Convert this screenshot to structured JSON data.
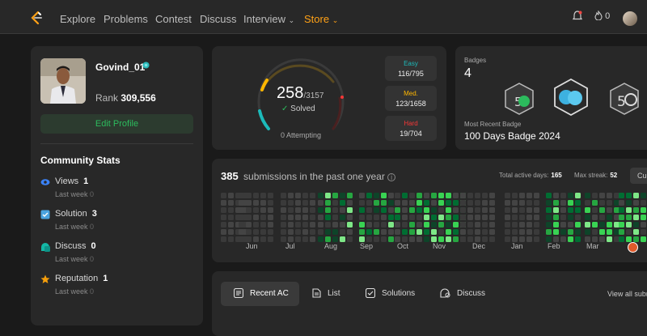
{
  "nav": {
    "links": [
      "Explore",
      "Problems",
      "Contest",
      "Discuss",
      "Interview",
      "Store"
    ],
    "coins": "0"
  },
  "profile": {
    "username": "Govind_01",
    "rank_label": "Rank",
    "rank_value": "309,556",
    "edit_label": "Edit Profile",
    "community_title": "Community Stats",
    "stats": [
      {
        "label": "Views",
        "value": "1",
        "sub_label": "Last week",
        "sub_value": "0",
        "icon": "eye-icon"
      },
      {
        "label": "Solution",
        "value": "3",
        "sub_label": "Last week",
        "sub_value": "0",
        "icon": "solution-icon"
      },
      {
        "label": "Discuss",
        "value": "0",
        "sub_label": "Last week",
        "sub_value": "0",
        "icon": "discuss-icon"
      },
      {
        "label": "Reputation",
        "value": "1",
        "sub_label": "Last week",
        "sub_value": "0",
        "icon": "star-icon"
      }
    ]
  },
  "solved": {
    "count": "258",
    "total": "/3157",
    "label": "Solved",
    "attempting": "0 Attempting",
    "easy": {
      "label": "Easy",
      "value": "116/795",
      "color": "#1cbaba"
    },
    "medium": {
      "label": "Med.",
      "value": "123/1658",
      "color": "#ffb700"
    },
    "hard": {
      "label": "Hard",
      "value": "19/704",
      "color": "#f63737"
    }
  },
  "badges": {
    "label": "Badges",
    "count": "4",
    "recent_label": "Most Recent Badge",
    "recent_name": "100 Days Badge 2024"
  },
  "submissions": {
    "count": "385",
    "text": "submissions in the past one year",
    "active_label": "Total active days:",
    "active_value": "165",
    "streak_label": "Max streak:",
    "streak_value": "52",
    "current_label": "Cur",
    "months": [
      "Jun",
      "Jul",
      "Aug",
      "Sep",
      "Oct",
      "Nov",
      "Dec",
      "Jan",
      "Feb",
      "Mar"
    ]
  },
  "tabs": {
    "items": [
      "Recent AC",
      "List",
      "Solutions",
      "Discuss"
    ],
    "view_all": "View all subr"
  }
}
